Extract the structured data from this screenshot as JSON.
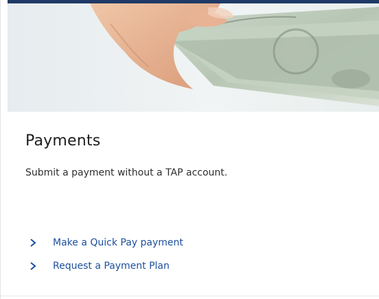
{
  "hero": {
    "image_subject": "hand holding dollar bills"
  },
  "card": {
    "title": "Payments",
    "description": "Submit a payment without a TAP account.",
    "links": [
      {
        "label": "Make a Quick Pay payment",
        "icon": "chevron-right-icon"
      },
      {
        "label": "Request a Payment Plan",
        "icon": "chevron-right-icon"
      }
    ]
  },
  "colors": {
    "accent_bar": "#1f3a66",
    "link": "#1c4f9c",
    "title": "#1d1d1d",
    "text": "#2f2f2f"
  }
}
